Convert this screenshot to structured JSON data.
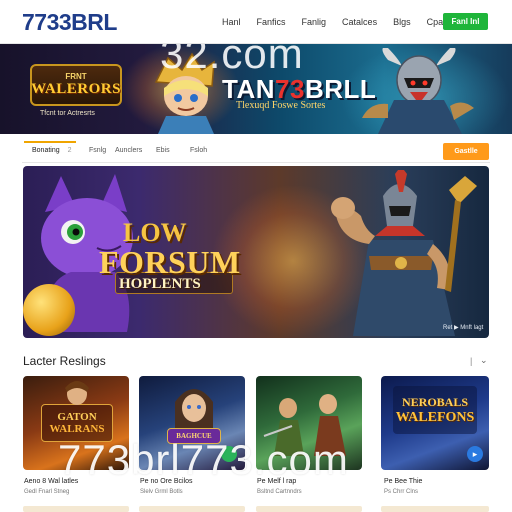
{
  "header": {
    "logo": "7733BRL",
    "nav": [
      "Hanl",
      "Fanfics",
      "Fanlig",
      "Catalces",
      "Blgs",
      "Cpalci"
    ],
    "cta": "Fanl Inl"
  },
  "hero": {
    "watermark": "32.com",
    "logo_top": "FRNT",
    "logo_main": "WALERORS",
    "caption": "Tfcnt tor Actresrts",
    "title_prefix": "TAN",
    "title_accent": "73",
    "title_suffix": "BRLL",
    "tagline": "Tlexuqd Foswe Sortes"
  },
  "tabs": {
    "items": [
      "Bonating",
      "Fsnlg",
      "Aunclers",
      "Ebis",
      "Fsloh"
    ],
    "active_suffix": "2",
    "button": "Gastlle"
  },
  "featured": {
    "line1": "LOW",
    "line2": "FORSUM",
    "line3": "HOPLENTS",
    "badge": "Ret ▶ Mnft lagt"
  },
  "latest": {
    "title": "Lacter Reslings",
    "cards": [
      {
        "caption": "Aeno 8 Wal latles",
        "meta": "Gedl  Fnarl  Stneg",
        "logo1": "GATON",
        "logo2": "WALRANS"
      },
      {
        "caption": "Pe no  Ore  Bcilos",
        "meta": "Slelv  Grml  Botls",
        "logo1": "BAGHCUE",
        "logo2": ""
      },
      {
        "caption": "Pe  Melf  l  rap",
        "meta": "Bsltnd  Cartnndrs",
        "logo1": "",
        "logo2": ""
      },
      {
        "caption": "Pe  Bee  Thie",
        "meta": "Ps  Chrr  Clns",
        "logo1": "NEROBALS",
        "logo2": "WALEFONS"
      }
    ],
    "watermark": "773brl773.com"
  },
  "colors": {
    "brand_blue": "#1f3d8a",
    "nav_cta_green": "#1fb53a",
    "tab_button_orange": "#ff9a1a",
    "tab_underline": "#f0a500"
  }
}
